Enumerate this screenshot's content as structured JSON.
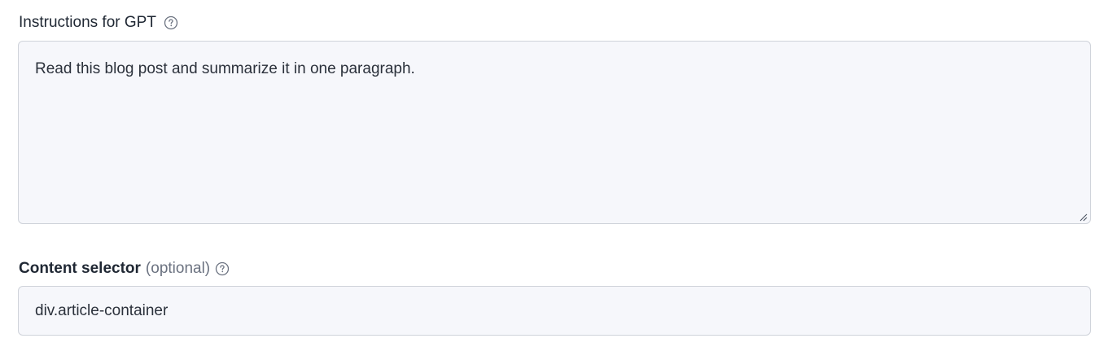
{
  "instructions": {
    "label": "Instructions for GPT",
    "help_icon": "question-circle-icon",
    "value": "Read this blog post and summarize it in one paragraph.",
    "resize_icon": "resize-grip-icon"
  },
  "selector": {
    "label": "Content selector",
    "optional_text": "(optional)",
    "help_icon": "question-circle-icon",
    "value": "div.article-container"
  },
  "colors": {
    "field_background": "#f6f7fb",
    "field_border": "#cfd3da",
    "label_text": "#1f2733",
    "muted_text": "#6b7280"
  }
}
